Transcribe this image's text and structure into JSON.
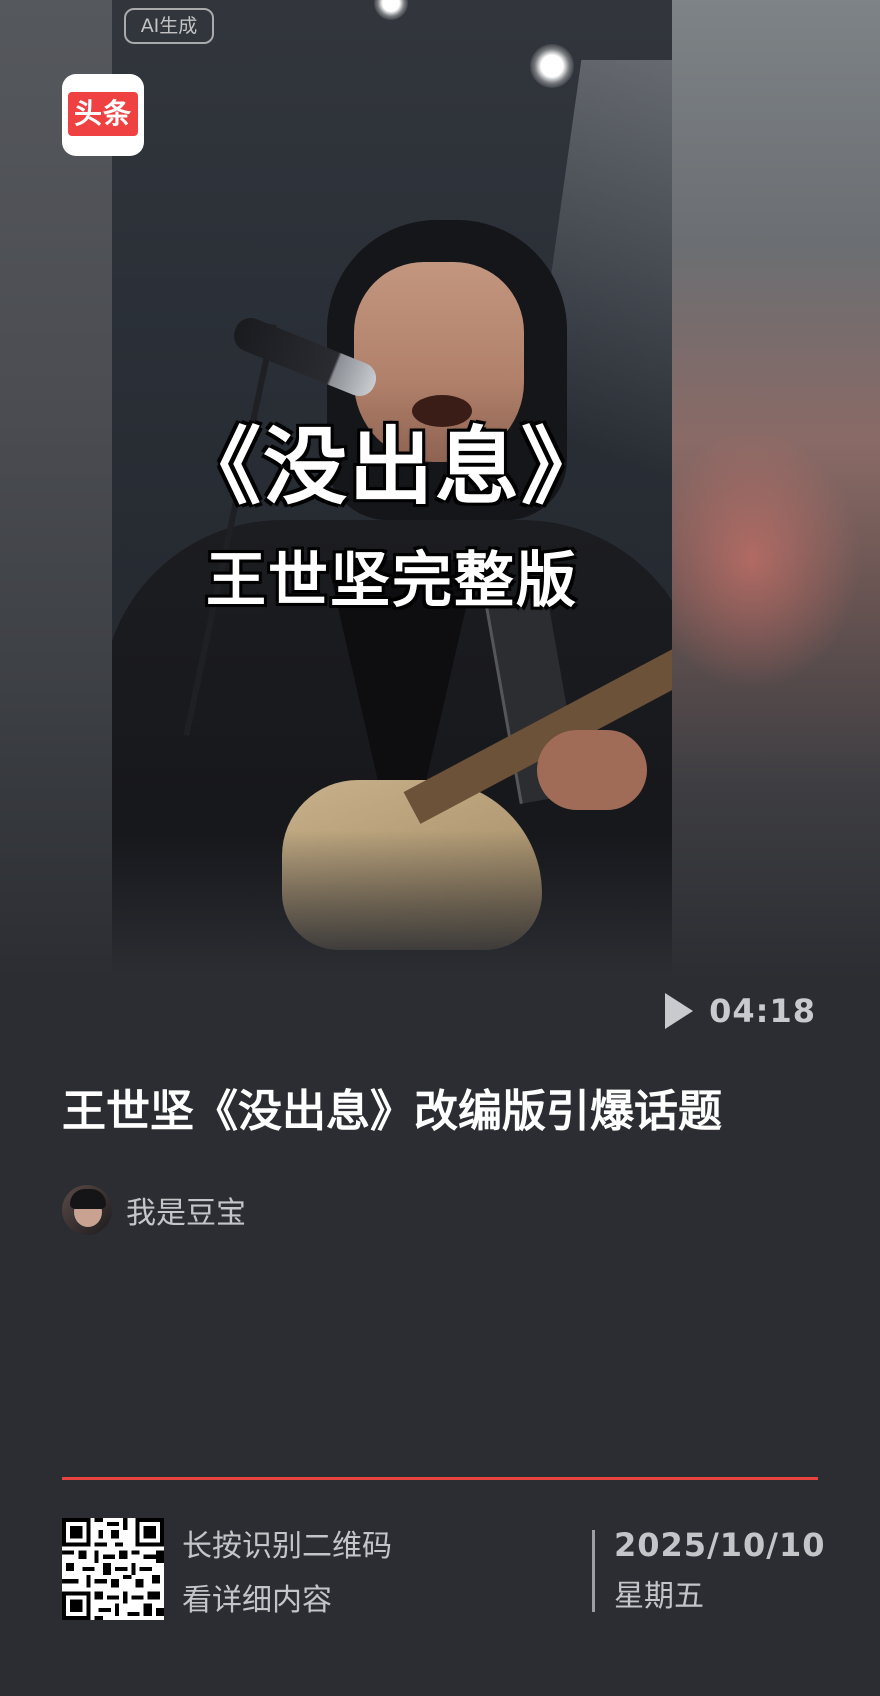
{
  "app": {
    "logo_text": "头条",
    "brand_color": "#f04142"
  },
  "video": {
    "ai_badge": "AI生成",
    "overlay_title": "《没出息》",
    "overlay_subtitle": "王世坚完整版",
    "duration": "04:18",
    "play_icon": "play-icon"
  },
  "article": {
    "headline": "王世坚《没出息》改编版引爆话题",
    "author_name": "我是豆宝"
  },
  "footer": {
    "divider_color": "#e8443f",
    "qr_line1": "长按识别二维码",
    "qr_line2": "看详细内容",
    "date": "2025/10/10",
    "weekday": "星期五"
  }
}
